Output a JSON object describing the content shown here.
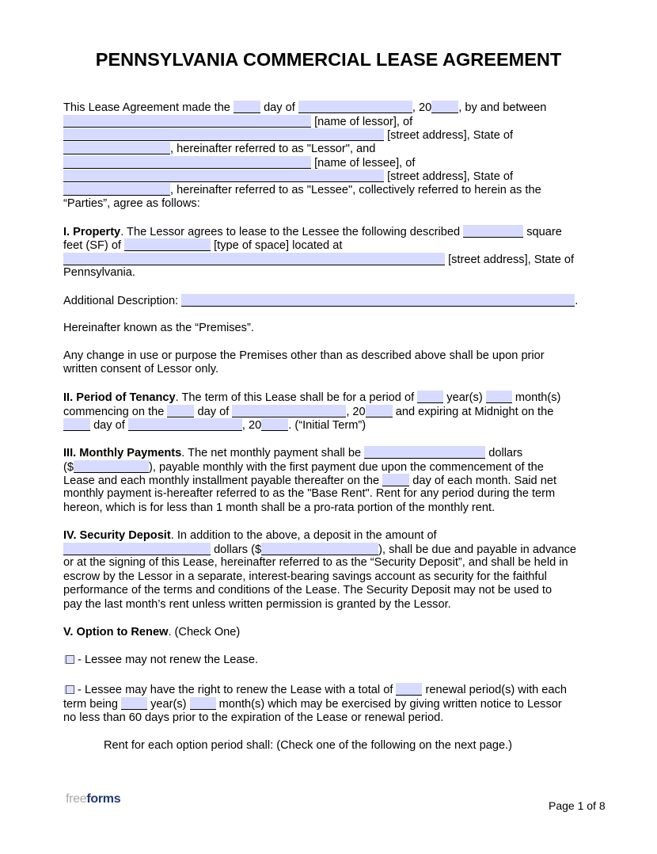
{
  "document": {
    "title": "PENNSYLVANIA COMMERCIAL LEASE AGREEMENT",
    "intro": {
      "t1": "This Lease Agreement made the",
      "t2": "day of",
      "t3": ", 20",
      "t4": ", by and between",
      "lessor_name_label": "[name of lessor], of",
      "lessor_address_label": "[street address], State of",
      "lessor_ref": ", hereinafter referred to as \"Lessor\", and",
      "lessee_name_label": "[name of lessee], of",
      "lessee_address_label": "[street address], State of",
      "lessee_ref": ", hereinafter referred to as \"Lessee\", collectively referred to herein as the",
      "parties": "“Parties”, agree as follows:"
    },
    "property": {
      "heading": "I. Property",
      "t1": ". The Lessor agrees to lease to the Lessee the following described",
      "t2": "square",
      "t3": "feet (SF) of",
      "t4": "[type of space] located at",
      "t5": "[street address], State of",
      "t6": "Pennsylvania.",
      "additional_label": "Additional Description:",
      "additional_end": ".",
      "premises": "Hereinafter known as the “Premises”.",
      "change_1": "Any change in use or purpose the Premises other than as described above shall be upon prior",
      "change_2": "written consent of Lessor only."
    },
    "tenancy": {
      "heading": "II. Period of Tenancy",
      "t1": ". The term of this Lease shall be for a period of",
      "t2": "year(s)",
      "t3": "month(s)",
      "t4": "commencing on the",
      "t5": "day of",
      "t6": ", 20",
      "t7": "and expiring at Midnight on the",
      "t8": "day of",
      "t9": ", 20",
      "t10": ". (“Initial Term”)"
    },
    "payments": {
      "heading": "III. Monthly Payments",
      "t1": ". The net monthly payment shall be",
      "t2": "dollars",
      "t3": "($",
      "t4": "), payable monthly with the first payment due upon the commencement of the",
      "t5": "Lease and each monthly installment payable thereafter on the",
      "t6": "day of each month. Said net",
      "t7": "monthly payment is-hereafter referred to as the \"Base Rent\". Rent for any period during the term",
      "t8": "hereon, which is for less than 1 month shall be a pro-rata portion of the monthly rent."
    },
    "deposit": {
      "heading": "IV. Security Deposit",
      "t1": ". In addition to the above, a deposit in the amount of",
      "t2": "dollars ($",
      "t3": "), shall be due and payable in advance",
      "t4": "or at the signing of this Lease, hereinafter referred to as the “Security Deposit”, and shall be held in",
      "t5": "escrow by the Lessor in a separate, interest-bearing savings account as security for the faithful",
      "t6": "performance of the terms and conditions of the Lease. The Security Deposit may not be used to",
      "t7": "pay the last month’s rent unless written permission is granted by the Lessor."
    },
    "renew": {
      "heading": "V. Option to Renew",
      "t1": ". (Check One)",
      "opt1": " - Lessee may not renew the Lease.",
      "opt2_a": " - Lessee may have the right to renew the Lease with a total of",
      "opt2_b": "renewal period(s) with each",
      "opt2_c": "term being",
      "opt2_d": "year(s)",
      "opt2_e": "month(s) which may be exercised by giving written notice to Lessor",
      "opt2_f": "no less than 60 days prior to the expiration of the Lease or renewal period.",
      "rent_note": "Rent for each option period shall: (Check one of the following on the next page.)"
    }
  },
  "footer": {
    "logo_free": "free",
    "logo_forms": "forms",
    "page": "Page 1 of 8"
  }
}
